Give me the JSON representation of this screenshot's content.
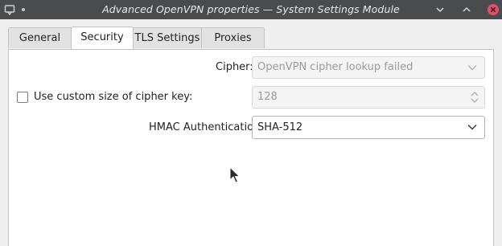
{
  "window": {
    "title": "Advanced OpenVPN properties — System Settings Module"
  },
  "tabs": [
    {
      "label": "General"
    },
    {
      "label": "Security"
    },
    {
      "label": "TLS Settings"
    },
    {
      "label": "Proxies"
    }
  ],
  "security": {
    "cipher_label": "Cipher:",
    "cipher_value": "OpenVPN cipher lookup failed",
    "custom_key_label": "Use custom size of cipher key:",
    "custom_key_checked": false,
    "key_size_value": "128",
    "hmac_label": "HMAC Authentication:",
    "hmac_value": "SHA-512"
  },
  "icons": {
    "app": "window-menu-icon",
    "minimize": "minimize-icon",
    "maximize": "maximize-icon",
    "close": "close-icon",
    "dropdown": "chevron-down-icon",
    "spinner": "spin-up-down-icon",
    "cursor": "mouse-pointer-icon"
  },
  "colors": {
    "titlebar": "#4a4b4d",
    "close_button": "#e0506a",
    "window_bg": "#efefef",
    "panel_bg": "#ffffff"
  }
}
